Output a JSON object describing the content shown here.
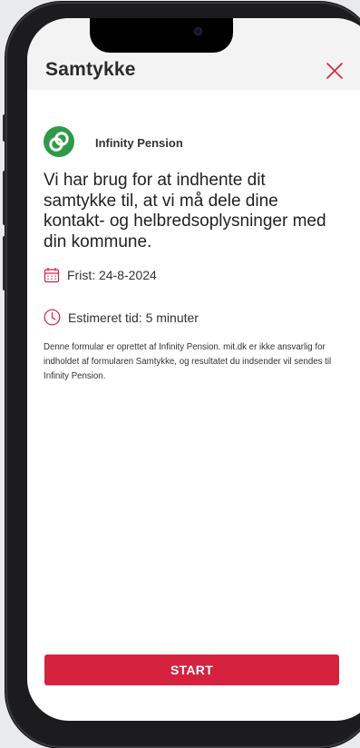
{
  "header": {
    "title": "Samtykke"
  },
  "provider": {
    "name": "Infinity Pension"
  },
  "main": {
    "heading": "Vi har brug for at indhente dit samtykke til, at vi må dele dine kontakt- og helbredsoplysninger med din kommune.",
    "deadline": "Frist: 24-8-2024",
    "estimate": "Estimeret tid: 5 minuter",
    "disclaimer": "Denne formular er oprettet af Infinity Pension. mit.dk er ikke ansvarlig for indholdet af formularen Samtykke, og resultatet du indsender vil sendes til Infinity Pension."
  },
  "actions": {
    "start_label": "START"
  },
  "icons": {
    "close": "close-icon",
    "provider_logo": "infinity-logo-icon",
    "deadline": "calendar-icon",
    "estimate": "clock-icon"
  },
  "colors": {
    "accent": "#d6223f",
    "provider": "#2e9a48",
    "header_bg": "#f4f3f3"
  }
}
